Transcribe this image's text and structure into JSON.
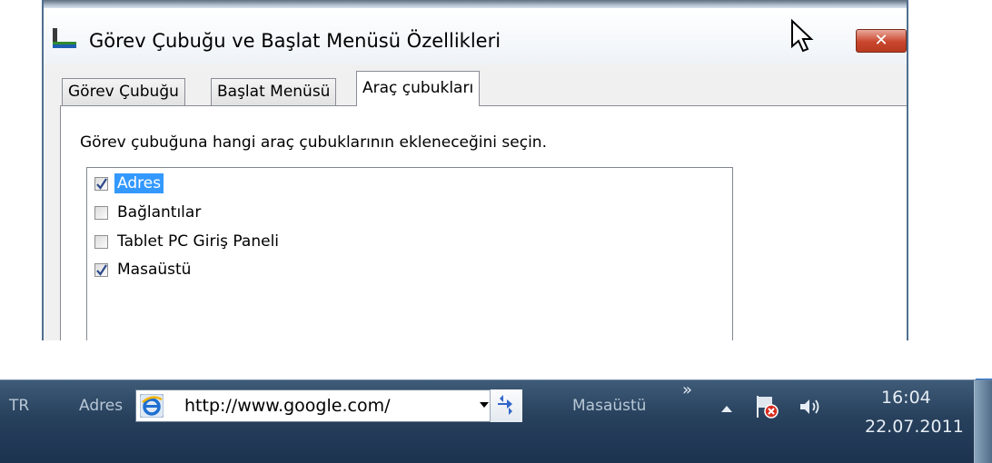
{
  "dialog": {
    "title": "Görev Çubuğu ve Başlat Menüsü Özellikleri",
    "close_label": "✕",
    "tabs": [
      {
        "label": "Görev Çubuğu",
        "active": false
      },
      {
        "label": "Başlat Menüsü",
        "active": false
      },
      {
        "label": "Araç çubukları",
        "active": true
      }
    ],
    "instruction": "Görev çubuğuna hangi araç çubuklarının ekleneceğini seçin.",
    "toolbars": [
      {
        "label": "Adres",
        "checked": true,
        "selected": true
      },
      {
        "label": "Bağlantılar",
        "checked": false,
        "selected": false
      },
      {
        "label": "Tablet PC Giriş Paneli",
        "checked": false,
        "selected": false
      },
      {
        "label": "Masaüstü",
        "checked": true,
        "selected": false
      }
    ]
  },
  "taskbar": {
    "language": "TR",
    "address_label": "Adres",
    "address_value": "http://www.google.com/",
    "desktop_toolbar_label": "Masaüstü",
    "overflow_chevron": "»",
    "clock_time": "16:04",
    "clock_date": "22.07.2011",
    "tray_icons": [
      "show-hidden-icons",
      "action-center-flag-icon",
      "volume-icon"
    ]
  },
  "colors": {
    "selection": "#3399ff",
    "close_button": "#c9462c",
    "taskbar": "#27405c"
  }
}
